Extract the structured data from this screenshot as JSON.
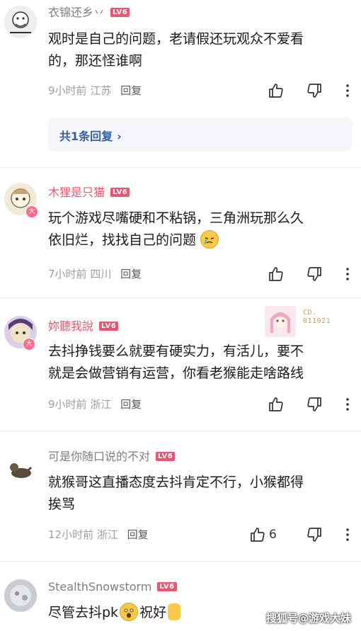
{
  "comments": [
    {
      "username": "衣锦还乡丷",
      "level": "LV6",
      "lines": [
        "观时是自己的问题，老请假还玩观众不爱看",
        "的，那还怪谁啊"
      ],
      "time": "9小时前",
      "location": "江苏",
      "reply_label": "回复",
      "reply_summary": "共1条回复",
      "reply_chevron": "›"
    },
    {
      "username": "木狸是只猫",
      "level": "LV6",
      "avatar_badge": "大",
      "lines": [
        "玩个游戏尽嘴硬和不粘锅，三角洲玩那么久",
        "依旧烂，找找自己的问题"
      ],
      "time": "7小时前",
      "location": "四川",
      "reply_label": "回复"
    },
    {
      "username": "妳聽我說",
      "level": "LV6",
      "avatar_badge": "大",
      "sticker_text": "CD.\n011021",
      "lines": [
        "去抖挣钱要么就要有硬实力，有活儿，要不",
        "就是会做营销有运营，你看老猴能走啥路线"
      ],
      "time": "9小时前",
      "location": "浙江",
      "reply_label": "回复"
    },
    {
      "username": "可是你随口说的不对",
      "level": "LV6",
      "lines": [
        "就猴哥这直播态度去抖肯定不行，小猴都得",
        "挨骂"
      ],
      "time": "12小时前",
      "location": "浙江",
      "reply_label": "回复",
      "like_count": "6"
    },
    {
      "username": "StealthSnowstorm",
      "level": "LV6",
      "lines": [
        "尽管去抖pk",
        "祝好"
      ]
    }
  ],
  "watermark": "搜狐号@游戏大妹",
  "icons": {
    "like": "thumbs-up-icon",
    "dislike": "thumbs-down-icon",
    "more": "more-vertical-icon"
  },
  "colors": {
    "level_badge": "#e8566f",
    "pink_username": "#e8566f",
    "gray_username": "#7a7f86",
    "reply_link": "#3a5f9e"
  }
}
